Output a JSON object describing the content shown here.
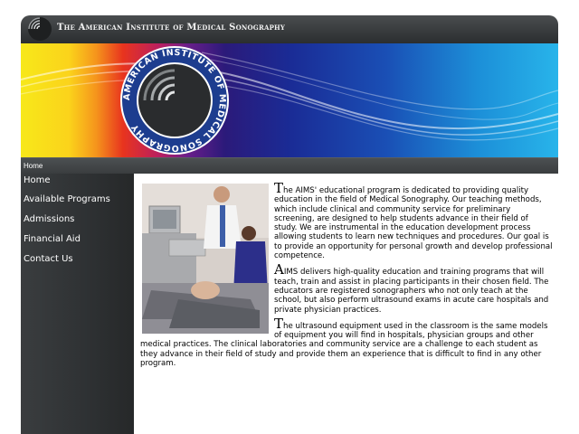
{
  "header": {
    "title": "The American Institute of Medical Sonography"
  },
  "banner": {
    "seal_text": "AMERICAN INSTITUTE OF MEDICAL SONOGRAPHY"
  },
  "breadcrumb": {
    "current": "Home"
  },
  "sidebar": {
    "items": [
      {
        "label": "Home"
      },
      {
        "label": "Available Programs"
      },
      {
        "label": "Admissions"
      },
      {
        "label": "Financial Aid"
      },
      {
        "label": "Contact Us"
      }
    ]
  },
  "content": {
    "paragraphs": [
      {
        "initial": "T",
        "rest": "he AIMS' educational program is dedicated to providing quality education in the field of Medical Sonography. Our teaching methods, which include clinical and community service for preliminary screening, are designed to help students advance in their field of study. We are instrumental in the education development process allowing students to learn new techniques and procedures. Our goal is to provide an opportunity for personal growth and develop professional competence."
      },
      {
        "initial": "A",
        "rest": "IMS delivers high-quality education and training programs that will teach, train and assist in placing participants in their chosen field. The educators are registered sonographers who not only teach at the school, but also perform ultrasound exams in acute care hospitals and private physician practices."
      },
      {
        "initial": "T",
        "rest": "he ultrasound equipment used in the classroom is the same models of equipment you will find in hospitals, physician groups and other medical practices. The clinical laboratories and community service are a challenge to each student as they advance in their field of study and provide them an experience that is difficult to find in any other program."
      }
    ]
  },
  "colors": {
    "header_bg": "#2b2e30",
    "sidebar_bg": "#2e3133",
    "seal_blue": "#1d3d8f",
    "content_bg": "#ffffff"
  }
}
